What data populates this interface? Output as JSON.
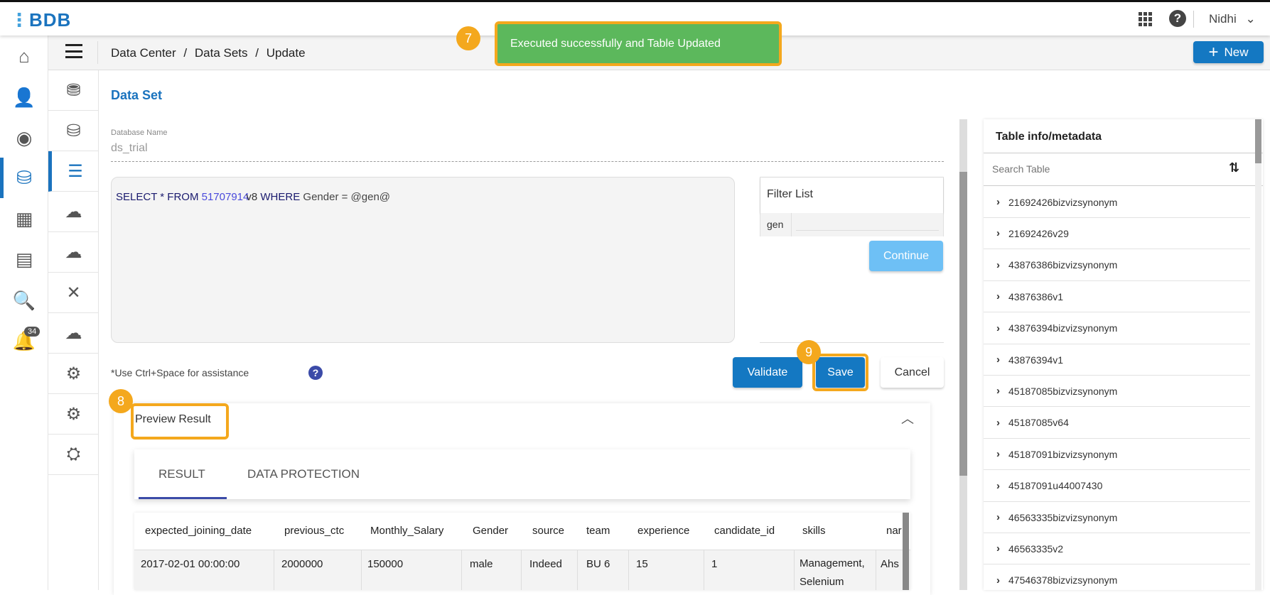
{
  "topbar": {
    "logo": "BDB",
    "user": "Nidhi"
  },
  "toast": {
    "message": "Executed successfully and Table Updated",
    "step": "7"
  },
  "breadcrumb": {
    "items": [
      "Data Center",
      "Data Sets",
      "Update"
    ],
    "sep": "/"
  },
  "new_button": "New",
  "notifications": {
    "count": "34"
  },
  "form": {
    "title": "Data Set",
    "db_label": "Database Name",
    "db_value": "ds_trial",
    "query": {
      "kw1": "SELECT",
      "star": "*",
      "kw2": "FROM",
      "table_num": "51707914",
      "table_suffix": "v8",
      "kw3": "WHERE",
      "rest": "Gender = @gen@"
    },
    "hint": "*Use Ctrl+Space for assistance",
    "filter": {
      "title": "Filter List",
      "param": "gen",
      "value": ""
    },
    "continue": "Continue",
    "validate": "Validate",
    "save": "Save",
    "save_step": "9",
    "cancel": "Cancel"
  },
  "preview": {
    "title": "Preview Result",
    "step": "8",
    "tabs": [
      "RESULT",
      "DATA PROTECTION"
    ],
    "columns": [
      "expected_joining_date",
      "previous_ctc",
      "Monthly_Salary",
      "Gender",
      "source",
      "team",
      "experience",
      "candidate_id",
      "skills",
      "nar"
    ],
    "rows": [
      [
        "2017-02-01 00:00:00",
        "2000000",
        "150000",
        "male",
        "Indeed",
        "BU 6",
        "15",
        "1",
        "Management, Selenium",
        "Ahs"
      ]
    ]
  },
  "table_panel": {
    "title": "Table info/metadata",
    "search_placeholder": "Search Table",
    "items": [
      "21692426bizvizsynonym",
      "21692426v29",
      "43876386bizvizsynonym",
      "43876386v1",
      "43876394bizvizsynonym",
      "43876394v1",
      "45187085bizvizsynonym",
      "45187085v64",
      "45187091bizvizsynonym",
      "45187091u44007430",
      "46563335bizvizsynonym",
      "46563335v2",
      "47546378bizvizsynonym"
    ]
  },
  "colors": {
    "primary": "#1478c2",
    "toast": "#5cb85c",
    "highlight": "#f4a81d",
    "continue": "#6ec0f5"
  }
}
